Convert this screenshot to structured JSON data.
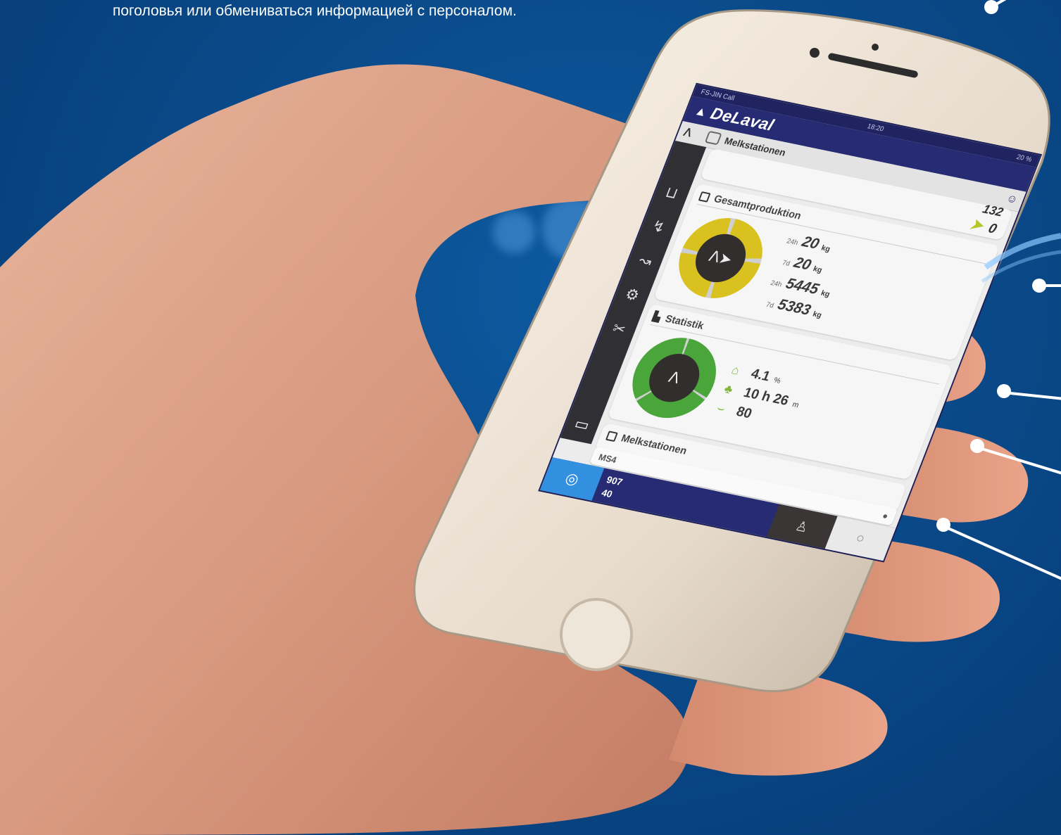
{
  "caption": "поголовья или обмениваться информацией с персоналом.",
  "app": {
    "status": {
      "carrier": "FS-JIN Call",
      "time": "18:20",
      "battery": "20 %"
    },
    "brand": "DeLaval",
    "tab_title": "Melkstationen",
    "sidebar_icons": [
      "wash-icon",
      "cow-run-icon",
      "cow-walk-icon",
      "gear-icon",
      "tool-icon"
    ],
    "top_card": {
      "value1": "132",
      "value2": "0"
    },
    "production": {
      "title": "Gesamtproduktion",
      "rows": [
        {
          "label": "24h",
          "value": "20",
          "unit": "kg"
        },
        {
          "label": "7d",
          "value": "20",
          "unit": "kg"
        },
        {
          "label": "24h",
          "value": "5445",
          "unit": "kg"
        },
        {
          "label": "7d",
          "value": "5383",
          "unit": "kg"
        }
      ]
    },
    "statistics": {
      "title": "Statistik",
      "kpis": [
        {
          "value": "4.1",
          "unit": "%"
        },
        {
          "value": "10 h 26",
          "unit": "m"
        },
        {
          "value": "80",
          "unit": ""
        }
      ]
    },
    "section3_title": "Melkstationen",
    "input": {
      "value": "MS4",
      "error": ""
    },
    "bottom": {
      "line1": "907",
      "line2": "40"
    }
  },
  "colors": {
    "background": "#0a4a8a",
    "header": "#262b73",
    "accent": "#3390e0",
    "yellow_ring": "#d9c21f",
    "green_ring": "#4aa63b"
  }
}
